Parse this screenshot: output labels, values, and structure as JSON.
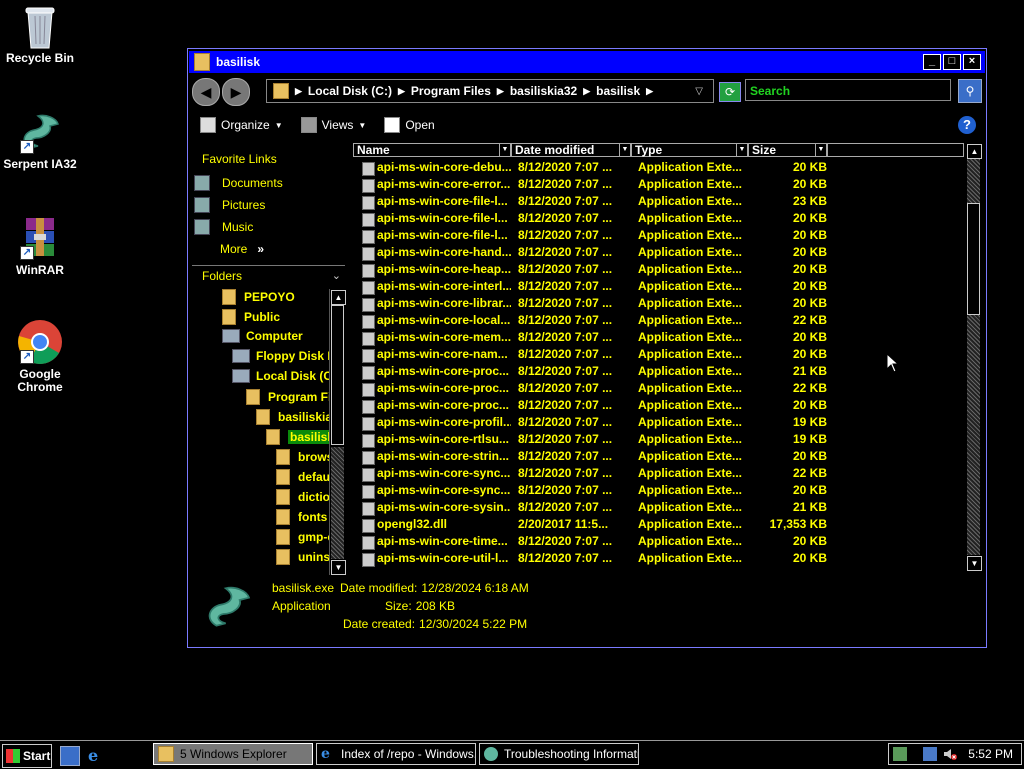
{
  "desktop": {
    "icons": [
      {
        "label": "Recycle Bin",
        "icon": "recycle-bin-icon"
      },
      {
        "label": "Serpent IA32",
        "icon": "serpent-icon"
      },
      {
        "label": "WinRAR",
        "icon": "winrar-icon"
      },
      {
        "label": "Google Chrome",
        "icon": "chrome-icon"
      }
    ]
  },
  "window": {
    "title": "basilisk",
    "controls": {
      "minimize": "_",
      "maximize": "□",
      "close": "×"
    },
    "address": {
      "crumbs": [
        "Local Disk (C:)",
        "Program Files",
        "basiliskia32",
        "basilisk"
      ],
      "search_placeholder": "Search"
    },
    "toolbar": {
      "organize": "Organize",
      "views": "Views",
      "open": "Open"
    },
    "favorite_links": {
      "title": "Favorite Links",
      "items": [
        "Documents",
        "Pictures",
        "Music"
      ],
      "more": "More"
    },
    "folders": {
      "title": "Folders",
      "tree": [
        "PEPOYO",
        "Public",
        "Computer",
        "Floppy Disk D",
        "Local Disk (C",
        "Program Fil",
        "basiliskia",
        "basilisk",
        "brows",
        "defau",
        "diction",
        "fonts",
        "gmp-c",
        "uninst"
      ]
    },
    "columns": [
      "Name",
      "Date modified",
      "Type",
      "Size"
    ],
    "files": [
      {
        "name": "api-ms-win-core-debu...",
        "date": "8/12/2020 7:07 ...",
        "type": "Application Exte...",
        "size": "20 KB"
      },
      {
        "name": "api-ms-win-core-error...",
        "date": "8/12/2020 7:07 ...",
        "type": "Application Exte...",
        "size": "20 KB"
      },
      {
        "name": "api-ms-win-core-file-l...",
        "date": "8/12/2020 7:07 ...",
        "type": "Application Exte...",
        "size": "23 KB"
      },
      {
        "name": "api-ms-win-core-file-l...",
        "date": "8/12/2020 7:07 ...",
        "type": "Application Exte...",
        "size": "20 KB"
      },
      {
        "name": "api-ms-win-core-file-l...",
        "date": "8/12/2020 7:07 ...",
        "type": "Application Exte...",
        "size": "20 KB"
      },
      {
        "name": "api-ms-win-core-hand...",
        "date": "8/12/2020 7:07 ...",
        "type": "Application Exte...",
        "size": "20 KB"
      },
      {
        "name": "api-ms-win-core-heap...",
        "date": "8/12/2020 7:07 ...",
        "type": "Application Exte...",
        "size": "20 KB"
      },
      {
        "name": "api-ms-win-core-interl...",
        "date": "8/12/2020 7:07 ...",
        "type": "Application Exte...",
        "size": "20 KB"
      },
      {
        "name": "api-ms-win-core-librar...",
        "date": "8/12/2020 7:07 ...",
        "type": "Application Exte...",
        "size": "20 KB"
      },
      {
        "name": "api-ms-win-core-local...",
        "date": "8/12/2020 7:07 ...",
        "type": "Application Exte...",
        "size": "22 KB"
      },
      {
        "name": "api-ms-win-core-mem...",
        "date": "8/12/2020 7:07 ...",
        "type": "Application Exte...",
        "size": "20 KB"
      },
      {
        "name": "api-ms-win-core-nam...",
        "date": "8/12/2020 7:07 ...",
        "type": "Application Exte...",
        "size": "20 KB"
      },
      {
        "name": "api-ms-win-core-proc...",
        "date": "8/12/2020 7:07 ...",
        "type": "Application Exte...",
        "size": "21 KB"
      },
      {
        "name": "api-ms-win-core-proc...",
        "date": "8/12/2020 7:07 ...",
        "type": "Application Exte...",
        "size": "22 KB"
      },
      {
        "name": "api-ms-win-core-proc...",
        "date": "8/12/2020 7:07 ...",
        "type": "Application Exte...",
        "size": "20 KB"
      },
      {
        "name": "api-ms-win-core-profil...",
        "date": "8/12/2020 7:07 ...",
        "type": "Application Exte...",
        "size": "19 KB"
      },
      {
        "name": "api-ms-win-core-rtlsu...",
        "date": "8/12/2020 7:07 ...",
        "type": "Application Exte...",
        "size": "19 KB"
      },
      {
        "name": "api-ms-win-core-strin...",
        "date": "8/12/2020 7:07 ...",
        "type": "Application Exte...",
        "size": "20 KB"
      },
      {
        "name": "api-ms-win-core-sync...",
        "date": "8/12/2020 7:07 ...",
        "type": "Application Exte...",
        "size": "22 KB"
      },
      {
        "name": "api-ms-win-core-sync...",
        "date": "8/12/2020 7:07 ...",
        "type": "Application Exte...",
        "size": "20 KB"
      },
      {
        "name": "api-ms-win-core-sysin...",
        "date": "8/12/2020 7:07 ...",
        "type": "Application Exte...",
        "size": "21 KB"
      },
      {
        "name": "opengl32.dll",
        "date": "2/20/2017 11:5...",
        "type": "Application Exte...",
        "size": "17,353 KB"
      },
      {
        "name": "api-ms-win-core-time...",
        "date": "8/12/2020 7:07 ...",
        "type": "Application Exte...",
        "size": "20 KB"
      },
      {
        "name": "api-ms-win-core-util-l...",
        "date": "8/12/2020 7:07 ...",
        "type": "Application Exte...",
        "size": "20 KB"
      }
    ],
    "details": {
      "filename": "basilisk.exe",
      "type": "Application",
      "date_modified_label": "Date modified:",
      "date_modified": "12/28/2024 6:18 AM",
      "size_label": "Size:",
      "size": "208 KB",
      "date_created_label": "Date created:",
      "date_created": "12/30/2024 5:22 PM"
    }
  },
  "taskbar": {
    "start": "Start",
    "tasks": [
      {
        "label": "5 Windows Explorer",
        "active": true
      },
      {
        "label": "Index of /repo - Windows...",
        "active": false
      },
      {
        "label": "Troubleshooting Informati...",
        "active": false
      }
    ],
    "clock": "5:52 PM"
  },
  "colors": {
    "title_bar": "#0000ff",
    "text_yellow": "#ffff00",
    "search_green": "#21d421",
    "selection_green": "#0a8a0a"
  }
}
